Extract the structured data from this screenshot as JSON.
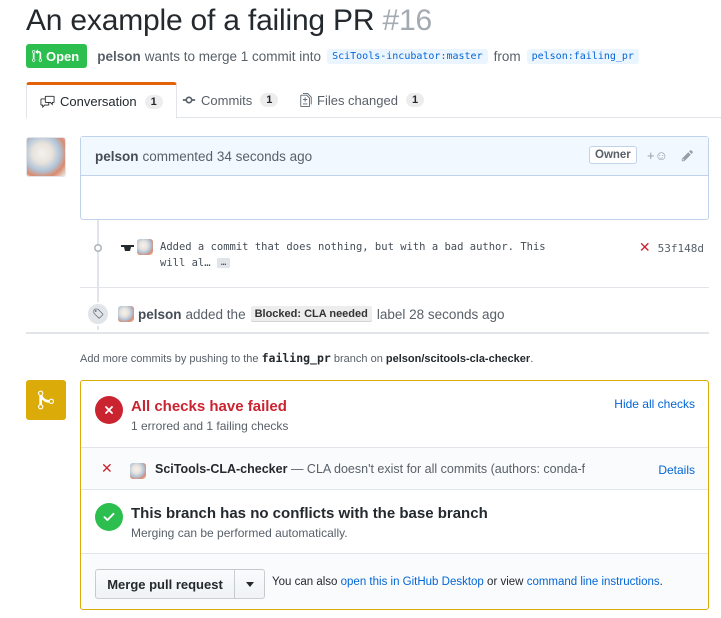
{
  "pr": {
    "title": "An example of a failing PR",
    "number": "#16",
    "state": "Open",
    "author": "pelson",
    "merge_text_1": "wants to merge 1 commit into",
    "base_branch": "SciTools-incubator:master",
    "merge_text_2": "from",
    "head_branch": "pelson:failing_pr"
  },
  "tabs": [
    {
      "label": "Conversation",
      "count": "1",
      "icon": "comment-discussion-icon"
    },
    {
      "label": "Commits",
      "count": "1",
      "icon": "git-commit-icon"
    },
    {
      "label": "Files changed",
      "count": "1",
      "icon": "file-diff-icon"
    }
  ],
  "comment": {
    "author": "pelson",
    "action": "commented",
    "time": "34 seconds ago",
    "badge": "Owner",
    "react_label": "+☺"
  },
  "commit": {
    "message": "Added a commit that does nothing, but with a bad author. This will al…",
    "ellipsis": "…",
    "sha": "53f148d",
    "status": "failed"
  },
  "label_event": {
    "actor": "pelson",
    "action": "added the",
    "label": "Blocked: CLA needed",
    "suffix": "label",
    "time": "28 seconds ago",
    "label_color": "#ededed"
  },
  "hint": {
    "prefix": "Add more commits by pushing to the",
    "branch": "failing_pr",
    "middle": "branch on",
    "repo": "pelson/scitools-cla-checker",
    "suffix": "."
  },
  "merge": {
    "checks_title": "All checks have failed",
    "checks_sub": "1 errored and 1 failing checks",
    "hide_checks": "Hide all checks",
    "check": {
      "name": "SciTools-CLA-checker",
      "desc": "— CLA doesn't exist for all commits (authors: conda-f…",
      "details": "Details"
    },
    "conflict_title": "This branch has no conflicts with the base branch",
    "conflict_sub": "Merging can be performed automatically.",
    "merge_button": "Merge pull request",
    "foot_prefix": "You can also",
    "foot_link1": "open this in GitHub Desktop",
    "foot_mid": "or view",
    "foot_link2": "command line instructions",
    "foot_suffix": "."
  },
  "colors": {
    "open_green": "#2cbe4e",
    "fail_red": "#cb2431",
    "merge_yellow": "#dbab09",
    "link_blue": "#0366d6",
    "tab_accent": "#e36209"
  }
}
